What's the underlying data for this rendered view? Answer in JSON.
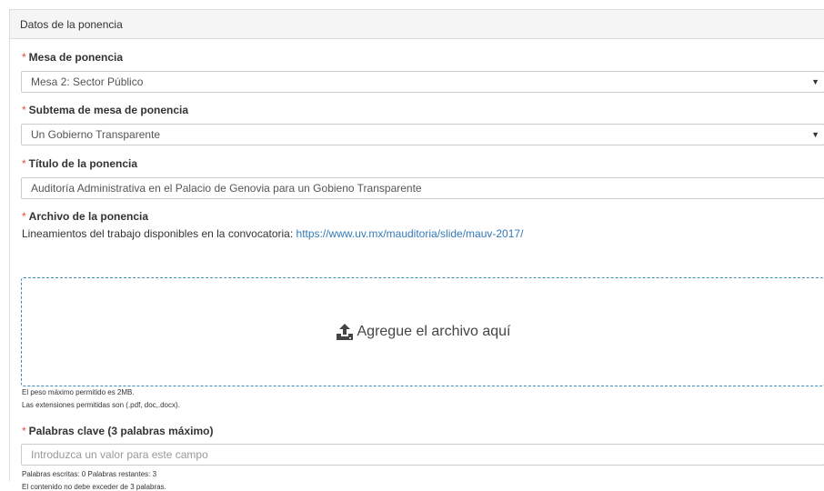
{
  "panel": {
    "title": "Datos de la ponencia"
  },
  "mesa": {
    "required_mark": "*",
    "label": "Mesa de ponencia",
    "selected": "Mesa 2: Sector Público"
  },
  "subtema": {
    "required_mark": "*",
    "label": "Subtema de mesa de ponencia",
    "selected": "Un Gobierno Transparente"
  },
  "titulo": {
    "required_mark": "*",
    "label": "Título de la ponencia",
    "value": "Auditoría Administrativa en el Palacio de Genovia para un Gobieno Transparente"
  },
  "archivo": {
    "required_mark": "*",
    "label": "Archivo de la ponencia",
    "guidelines_text": "Lineamientos del trabajo disponibles en la convocatoria: ",
    "guidelines_link": "https://www.uv.mx/mauditoria/slide/mauv-2017/",
    "dropzone_text": "Agregue el archivo aquí",
    "dropzone_icon": "upload-icon",
    "max_size_note": "El peso máximo permitido es 2MB.",
    "extensions_note": "Las extensiones permitidas son (.pdf, doc,.docx)."
  },
  "palabras": {
    "required_mark": "*",
    "label": "Palabras clave (3 palabras máximo)",
    "placeholder": "Introduzca un valor para este campo",
    "counter": "Palabras escritas: 0 Palabras restantes: 3",
    "limit_note": "El contenido no debe exceder de 3 palabras."
  },
  "colors": {
    "required": "#e74c3c",
    "link": "#337ab7",
    "dropzone_border": "#3c8dbc"
  }
}
